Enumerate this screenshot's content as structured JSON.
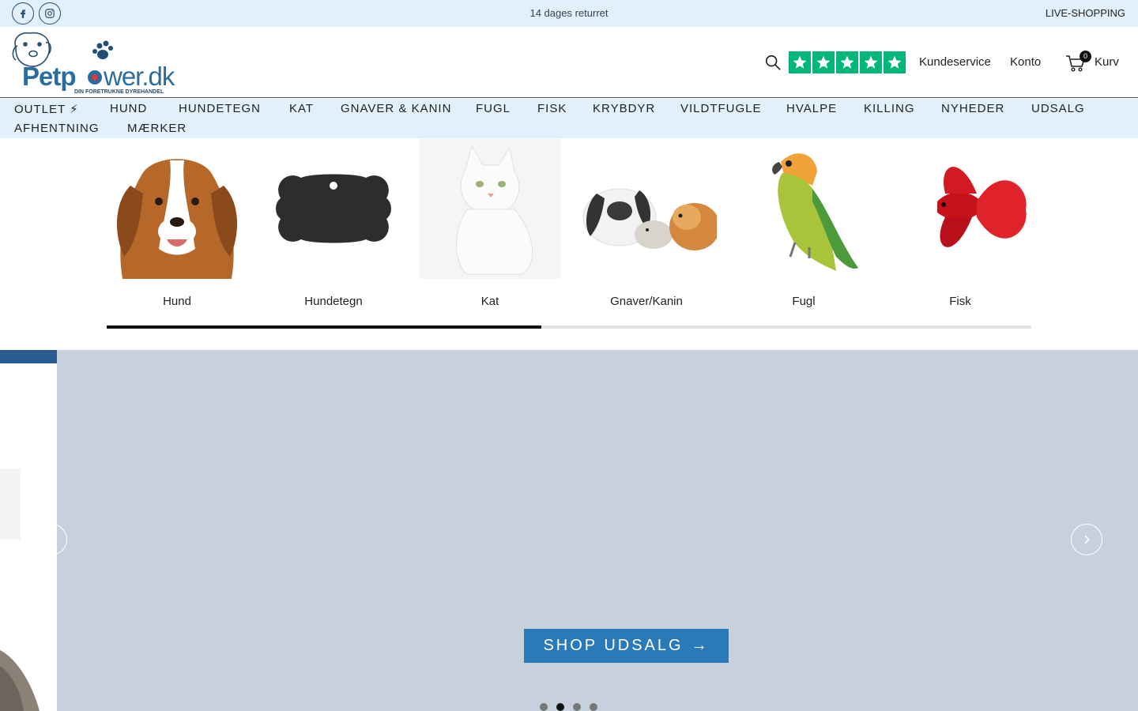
{
  "topbar": {
    "announcement": "14 dages returret",
    "live_shopping": "LIVE-SHOPPING",
    "social": [
      "facebook-icon",
      "instagram-icon"
    ]
  },
  "header": {
    "logo_text": "Petpower.dk",
    "logo_tagline": "DIN FORETRUKNE DYREHANDEL",
    "trustpilot_stars": 5,
    "customer_service": "Kundeservice",
    "account": "Konto",
    "cart_count": "0",
    "cart_label": "Kurv"
  },
  "nav": {
    "items": [
      "OUTLET ⚡",
      "HUND",
      "HUNDETEGN",
      "KAT",
      "GNAVER & KANIN",
      "FUGL",
      "FISK",
      "KRYBDYR",
      "VILDTFUGLE",
      "HVALPE",
      "KILLING",
      "NYHEDER",
      "UDSALG",
      "AFHENTNING",
      "MÆRKER"
    ]
  },
  "categories": {
    "items": [
      "Hund",
      "Hundetegn",
      "Kat",
      "Gnaver/Kanin",
      "Fugl",
      "Fisk"
    ],
    "scroll_progress": 0.47
  },
  "hero": {
    "cta_label": "SHOP UDSALG",
    "cta_arrow": "→",
    "slide_count": 4,
    "active_slide": 2
  },
  "colors": {
    "topbar_bg": "#e1f0fa",
    "accent": "#2a7ab8",
    "trustpilot": "#00b67a",
    "hero_bg": "#c7d1dd"
  }
}
